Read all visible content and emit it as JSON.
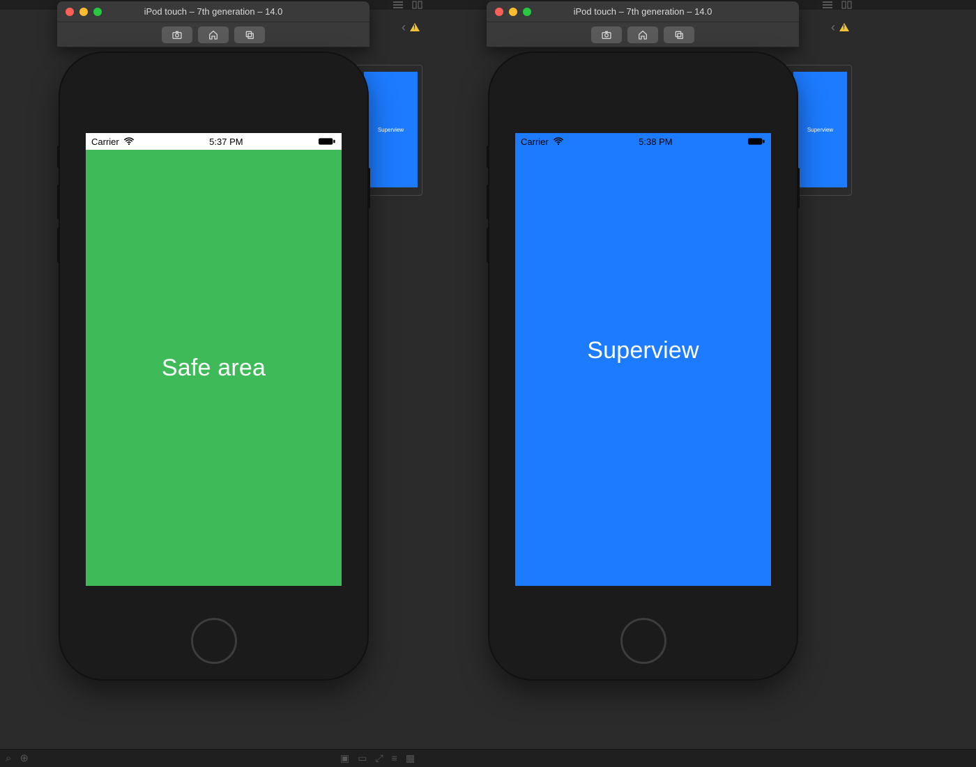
{
  "left": {
    "window_title": "iPod touch – 7th generation – 14.0",
    "status": {
      "carrier": "Carrier",
      "time": "5:37 PM"
    },
    "content_label": "Safe area",
    "content_bg": "#3fba58",
    "status_style": "light",
    "ib_label": "Superview"
  },
  "right": {
    "window_title": "iPod touch – 7th generation – 14.0",
    "status": {
      "carrier": "Carrier",
      "time": "5:38 PM"
    },
    "content_label": "Superview",
    "content_bg": "#1d7bff",
    "status_style": "over",
    "ib_label": "Superview"
  },
  "colors": {
    "blue": "#1d7bff",
    "green": "#3fba58"
  }
}
